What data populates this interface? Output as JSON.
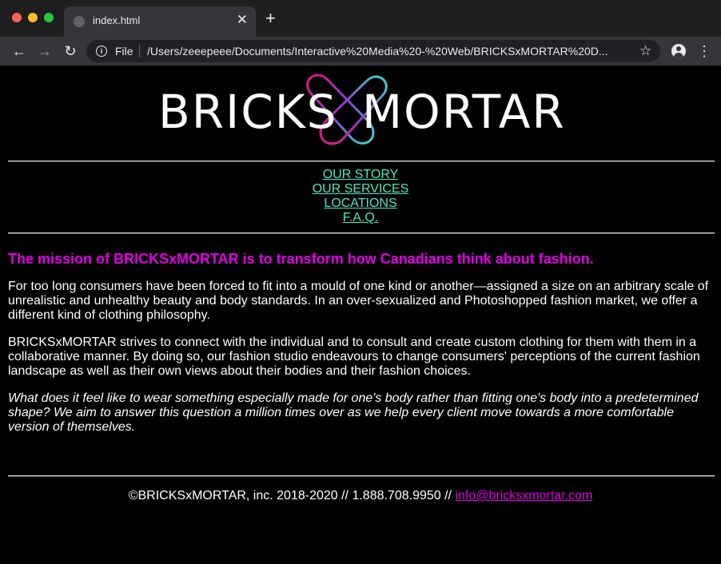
{
  "browser": {
    "tab_title": "index.html",
    "tab_close": "✕",
    "new_tab": "+",
    "scheme_label": "File",
    "url": "/Users/zeeepeee/Documents/Interactive%20Media%20-%20Web/BRICKSxMORTAR%20D..."
  },
  "logo": {
    "text_left": "BRICKS",
    "text_right": "MORTAR",
    "accent_colors": [
      "#e6157e",
      "#3dd6c9",
      "#8c3fc7"
    ]
  },
  "nav": {
    "items": [
      {
        "label": "OUR STORY"
      },
      {
        "label": "OUR SERVICES"
      },
      {
        "label": "LOCATIONS"
      },
      {
        "label": "F.A.Q."
      }
    ]
  },
  "content": {
    "mission": "The mission of BRICKSxMORTAR is to transform how Canadians think about fashion.",
    "p1": "For too long consumers have been forced to fit into a mould of one kind or another—assigned a size on an arbitrary scale of unrealistic and unhealthy beauty and body standards. In an over-sexualized and Photoshopped fashion market, we offer a different kind of clothing philosophy.",
    "p2": "BRICKSxMORTAR strives to connect with the individual and to consult and create custom clothing for them with them in a collaborative manner. By doing so, our fashion studio endeavours to change consumers' perceptions of the current fashion landscape as well as their own views about their bodies and their fashion choices.",
    "p3": "What does it feel like to wear something especially made for one's body rather than fitting one's body into a predetermined shape? We aim to answer this question a million times over as we help every client move towards a more comfortable version of themselves."
  },
  "footer": {
    "text": "©BRICKSxMORTAR, inc. 2018-2020 // 1.888.708.9950 // ",
    "email": "info@bricksxmortar.com"
  },
  "colors": {
    "nav_link": "#4ee7c4",
    "accent": "#e100e5",
    "background": "#000000"
  }
}
